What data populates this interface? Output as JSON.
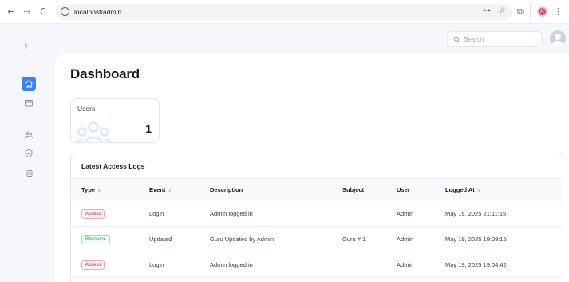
{
  "browser": {
    "back_icon": "←",
    "forward_icon": "→",
    "reload_icon": "C",
    "info_icon": "i",
    "url": "localhost/admin",
    "key_icon": "⊶",
    "star_icon": "☆",
    "extensions_icon": "⧉",
    "profile_initial": "A",
    "menu_icon": "⋮"
  },
  "sidebar": {
    "toggle_icon": "›",
    "items": [
      {
        "icon": "home-icon",
        "active": true
      },
      {
        "icon": "box-icon",
        "active": false
      },
      {
        "icon": "users-icon",
        "active": false
      },
      {
        "icon": "shield-icon",
        "active": false
      },
      {
        "icon": "copy-icon",
        "active": false
      }
    ]
  },
  "header": {
    "search_placeholder": "Search"
  },
  "page": {
    "title": "Dashboard"
  },
  "stats": {
    "users_label": "Users",
    "users_value": "1"
  },
  "logs": {
    "title": "Latest Access Logs",
    "columns": [
      "Type",
      "Event",
      "Description",
      "Subject",
      "User",
      "Logged At"
    ],
    "sortable": [
      true,
      true,
      false,
      false,
      false,
      true
    ],
    "rows": [
      {
        "type": "Access",
        "event": "Login",
        "description": "Admin logged in",
        "subject": "",
        "user": "Admin",
        "logged_at": "May 19, 2025 21:11:15"
      },
      {
        "type": "Resource",
        "event": "Updated",
        "description": "Guru Updated by Admin",
        "subject": "Guru # 1",
        "user": "Admin",
        "logged_at": "May 19, 2025 19:08:15"
      },
      {
        "type": "Access",
        "event": "Login",
        "description": "Admin logged in",
        "subject": "",
        "user": "Admin",
        "logged_at": "May 19, 2025 19:04:42"
      }
    ]
  },
  "colors": {
    "accent": "#3b82f6",
    "access_badge": "#dc2626",
    "resource_badge": "#16a34a",
    "app_background": "#f5f7fc"
  }
}
